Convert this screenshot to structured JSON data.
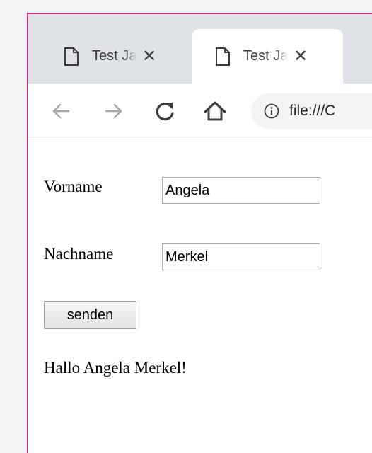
{
  "tabs": [
    {
      "title": "Test JavaScript",
      "close_symbol": "✕",
      "active": false
    },
    {
      "title": "Test JavaScript",
      "close_symbol": "✕",
      "active": true
    }
  ],
  "toolbar": {
    "back_icon": "arrow-left-icon",
    "forward_icon": "arrow-right-icon",
    "reload_icon": "reload-icon",
    "home_icon": "home-icon",
    "url": "file:///C"
  },
  "form": {
    "firstname_label": "Vorname",
    "firstname_value": "Angela",
    "lastname_label": "Nachname",
    "lastname_value": "Merkel",
    "submit_label": "senden"
  },
  "output": {
    "greeting": "Hallo Angela Merkel!"
  },
  "colors": {
    "window_border": "#c2307e",
    "tabstrip": "#dee1e6",
    "omnibox": "#f1f3f4"
  }
}
